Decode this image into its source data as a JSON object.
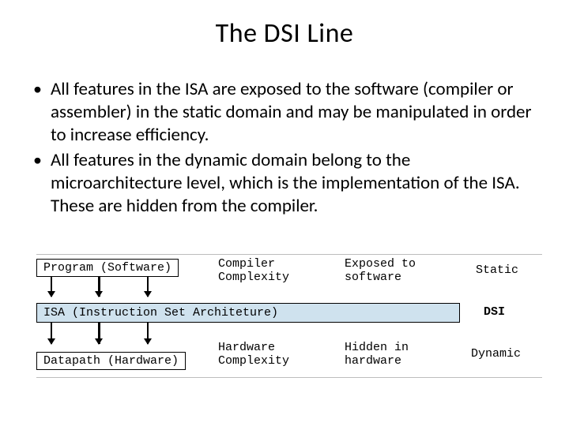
{
  "title": "The DSI Line",
  "bullets": [
    "All features in the ISA are exposed to the software (compiler or assembler) in the static domain and may be manipulated in order to increase efficiency.",
    "All features in the dynamic domain belong to the microarchitecture level, which is the implementation of the ISA.  These are hidden from the compiler."
  ],
  "diagram": {
    "program_label": "Program (Software)",
    "isa_label": "ISA (Instruction Set Architeture)",
    "datapath_label": "Datapath (Hardware)",
    "compiler_complexity": "Compiler\nComplexity",
    "hardware_complexity": "Hardware\nComplexity",
    "exposed": "Exposed to\nsoftware",
    "hidden": "Hidden in\nhardware",
    "static": "Static",
    "dynamic": "Dynamic",
    "dsi": "DSI"
  }
}
